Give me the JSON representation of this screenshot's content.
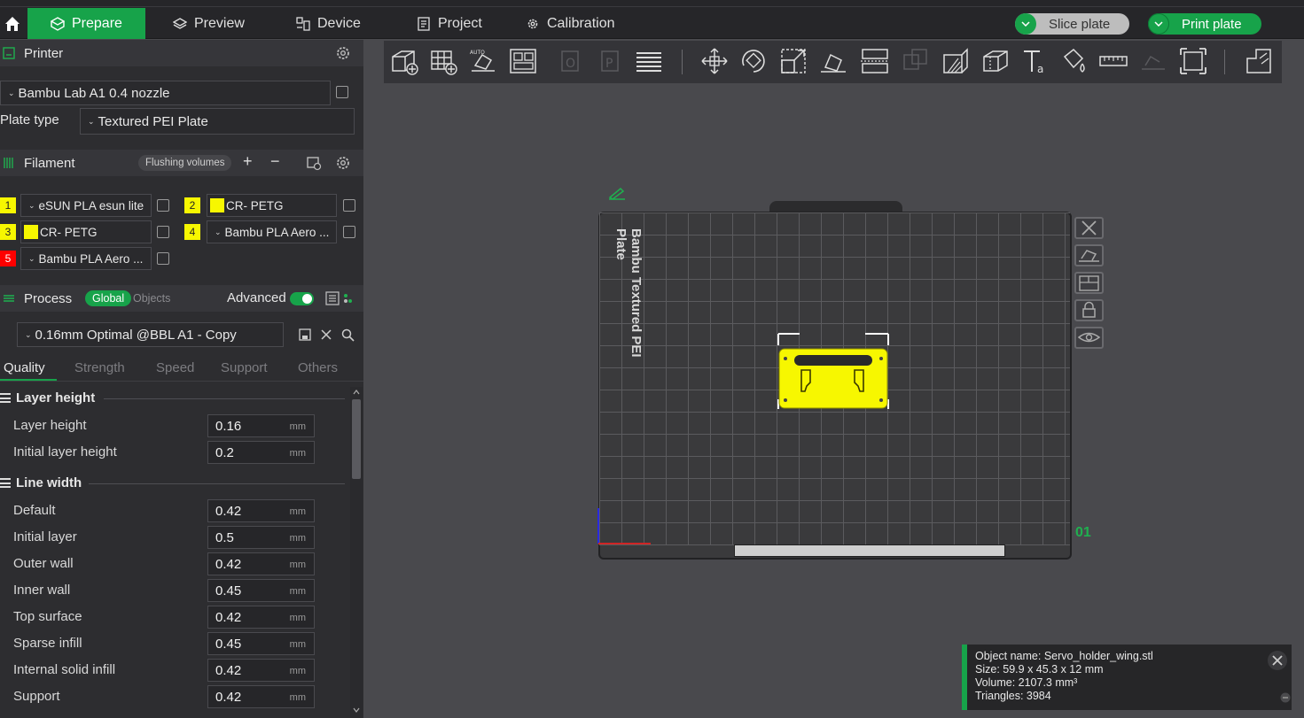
{
  "menu": {
    "tabs": [
      {
        "label": "Prepare"
      },
      {
        "label": "Preview"
      },
      {
        "label": "Device"
      },
      {
        "label": "Project"
      },
      {
        "label": "Calibration"
      }
    ],
    "slice_label": "Slice plate",
    "print_label": "Print plate"
  },
  "printer": {
    "section_title": "Printer",
    "name": "Bambu Lab A1 0.4 nozzle",
    "plate_type_label": "Plate type",
    "plate_type_value": "Textured PEI Plate"
  },
  "filament": {
    "section_title": "Filament",
    "flushing_label": "Flushing volumes",
    "plus": "+",
    "minus": "−",
    "items": [
      {
        "num": "1",
        "name": "eSUN PLA esun lite",
        "color": "#f7f700"
      },
      {
        "num": "2",
        "name": "CR- PETG",
        "color": "#f7f700"
      },
      {
        "num": "3",
        "name": "CR- PETG",
        "color": "#f7f700"
      },
      {
        "num": "4",
        "name": "Bambu PLA Aero ...",
        "color": "#f7f700"
      },
      {
        "num": "5",
        "name": "Bambu PLA Aero ...",
        "color": "#ff0000"
      }
    ]
  },
  "process": {
    "section_title": "Process",
    "global_label": "Global",
    "objects_label": "Objects",
    "advanced_label": "Advanced",
    "preset": "0.16mm Optimal @BBL A1 - Copy",
    "tabs": [
      "Quality",
      "Strength",
      "Speed",
      "Support",
      "Others"
    ],
    "groups": {
      "layer_height": {
        "title": "Layer height",
        "rows": [
          {
            "label": "Layer height",
            "value": "0.16",
            "unit": "mm"
          },
          {
            "label": "Initial layer height",
            "value": "0.2",
            "unit": "mm"
          }
        ]
      },
      "line_width": {
        "title": "Line width",
        "rows": [
          {
            "label": "Default",
            "value": "0.42",
            "unit": "mm"
          },
          {
            "label": "Initial layer",
            "value": "0.5",
            "unit": "mm"
          },
          {
            "label": "Outer wall",
            "value": "0.42",
            "unit": "mm"
          },
          {
            "label": "Inner wall",
            "value": "0.45",
            "unit": "mm"
          },
          {
            "label": "Top surface",
            "value": "0.42",
            "unit": "mm"
          },
          {
            "label": "Sparse infill",
            "value": "0.45",
            "unit": "mm"
          },
          {
            "label": "Internal solid infill",
            "value": "0.42",
            "unit": "mm"
          },
          {
            "label": "Support",
            "value": "0.42",
            "unit": "mm"
          }
        ]
      }
    }
  },
  "plate": {
    "label": "Bambu Textured PEI Plate",
    "number": "01"
  },
  "object_info": {
    "name_line": "Object name: Servo_holder_wing.stl",
    "size_line": "Size: 59.9 x 45.3 x 12 mm",
    "volume_line": "Volume: 2107.3 mm³",
    "triangles_line": "Triangles: 3984"
  },
  "colors": {
    "accent": "#17a34a",
    "object": "#f7f700"
  }
}
